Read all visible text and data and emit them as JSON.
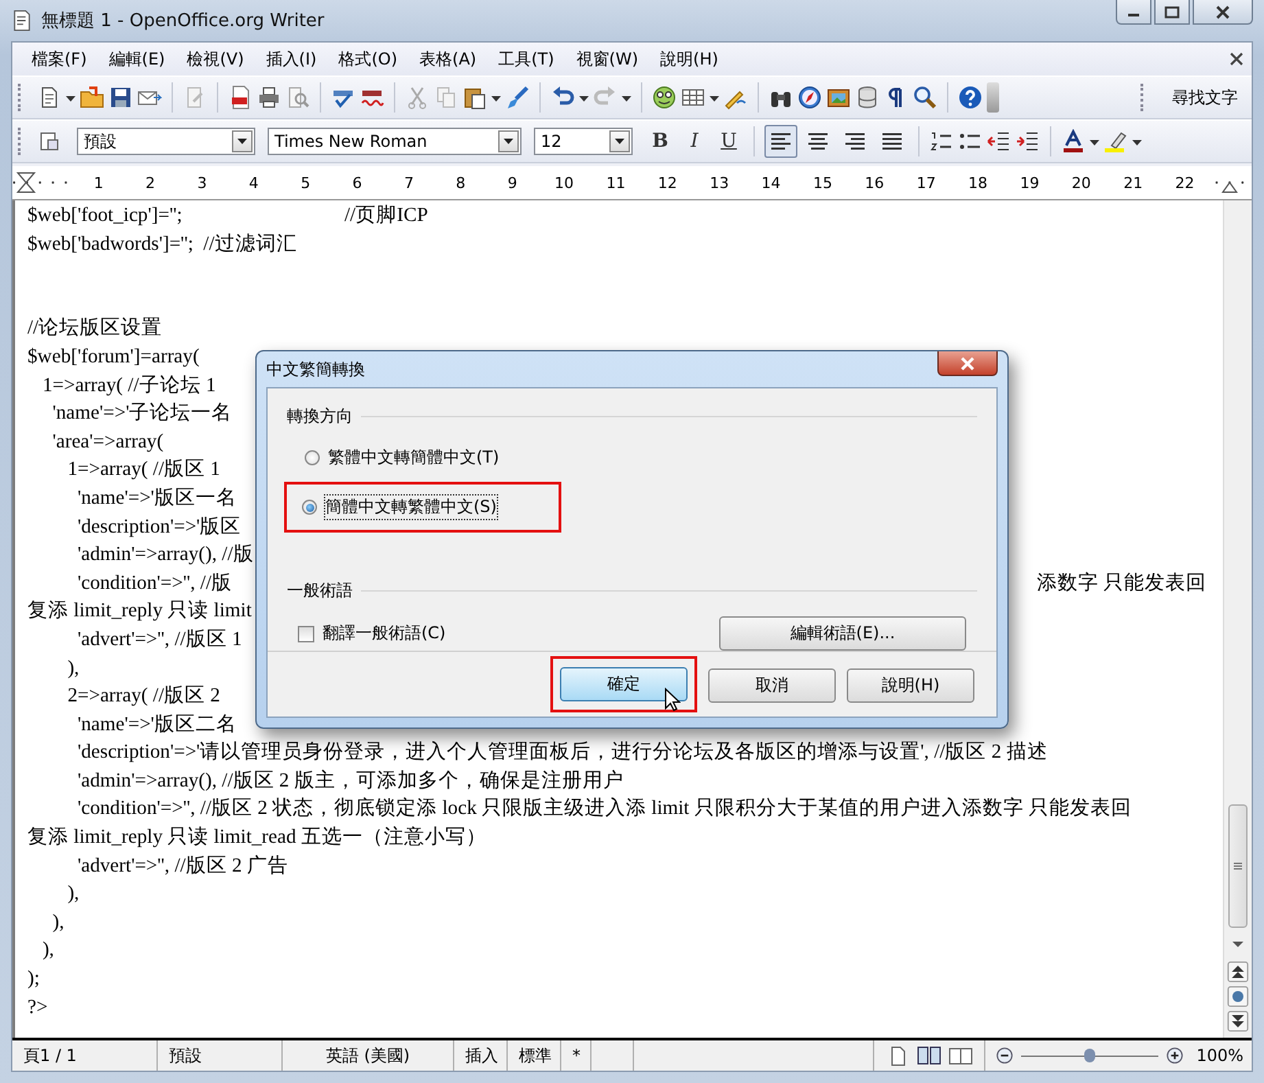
{
  "window": {
    "title": "無標題 1 - OpenOffice.org Writer"
  },
  "menu": [
    "檔案(F)",
    "編輯(E)",
    "檢視(V)",
    "插入(I)",
    "格式(O)",
    "表格(A)",
    "工具(T)",
    "視窗(W)",
    "說明(H)"
  ],
  "find_label": "尋找文字",
  "format_bar": {
    "style": "預設",
    "font": "Times New Roman",
    "size": "12",
    "text_styles": [
      {
        "label": "B",
        "kind": "bold"
      },
      {
        "label": "I",
        "kind": "italic"
      },
      {
        "label": "U",
        "kind": "underline"
      }
    ],
    "alignment": [
      {
        "kind": "left",
        "selected": true
      },
      {
        "kind": "center",
        "selected": false
      },
      {
        "kind": "right",
        "selected": false
      },
      {
        "kind": "justify",
        "selected": false
      }
    ]
  },
  "ruler": [
    "1",
    "2",
    "3",
    "4",
    "5",
    "6",
    "7",
    "8",
    "9",
    "10",
    "11",
    "12",
    "13",
    "14",
    "15",
    "16",
    "17",
    "18",
    "19",
    "20",
    "21",
    "22"
  ],
  "document": [
    {
      "text": "$web['foot_icp']='';",
      "comment": "//页脚ICP"
    },
    {
      "text": "$web['badwords']='';  //过滤词汇"
    },
    {
      "text": "//论坛版区设置",
      "spaced": true
    },
    {
      "text": "$web['forum']=array("
    },
    {
      "text": "   1=>array( //子论坛 1"
    },
    {
      "text": "     'name'=>'子论坛一名"
    },
    {
      "text": "     'area'=>array("
    },
    {
      "text": "        1=>array( //版区 1"
    },
    {
      "text": "          'name'=>'版区一名"
    },
    {
      "text": "          'description'=>'版区"
    },
    {
      "text": "          'admin'=>array(), //版"
    },
    {
      "text": "          'condition'=>'', //版",
      "tail": "添数字 只能发表回"
    },
    {
      "text": "复添 limit_reply 只读 limit"
    },
    {
      "text": "          'advert'=>'', //版区 1"
    },
    {
      "text": "        ),"
    },
    {
      "text": "        2=>array( //版区 2"
    },
    {
      "text": "          'name'=>'版区二名"
    },
    {
      "text": "          'description'=>'请以管理员身份登录，进入个人管理面板后，进行分论坛及各版区的增添与设置', //版区 2 描述"
    },
    {
      "text": "          'admin'=>array(), //版区 2 版主，可添加多个，确保是注册用户"
    },
    {
      "text": "          'condition'=>'', //版区 2 状态，彻底锁定添 lock 只限版主级进入添 limit 只限积分大于某值的用户进入添数字 只能发表回"
    },
    {
      "text": "复添 limit_reply 只读 limit_read 五选一（注意小写）"
    },
    {
      "text": "          'advert'=>'', //版区 2 广告"
    },
    {
      "text": "        ),"
    },
    {
      "text": "     ),"
    },
    {
      "text": "   ),"
    },
    {
      "text": ");"
    },
    {
      "text": "?>"
    }
  ],
  "dialog": {
    "title": "中文繁簡轉換",
    "direction_group": "轉換方向",
    "directions": [
      {
        "label": "繁體中文轉簡體中文(T)",
        "selected": false,
        "highlighted": false
      },
      {
        "label": "簡體中文轉繁體中文(S)",
        "selected": true,
        "highlighted": true
      }
    ],
    "terms_group": "一般術語",
    "translate_terms": {
      "label": "翻譯一般術語(C)",
      "checked": false
    },
    "edit_terms": "編輯術語(E)...",
    "buttons": [
      {
        "label": "確定",
        "default": true,
        "highlighted": true
      },
      {
        "label": "取消",
        "default": false,
        "highlighted": false
      },
      {
        "label": "說明(H)",
        "default": false,
        "highlighted": false
      }
    ]
  },
  "status_bar": {
    "page": "頁1 / 1",
    "style": "預設",
    "language": "英語 (美國)",
    "insert_mode": "插入",
    "selection_mode": "標準",
    "modified": "*",
    "zoom": {
      "level": 0.5,
      "reading": "100%"
    }
  }
}
